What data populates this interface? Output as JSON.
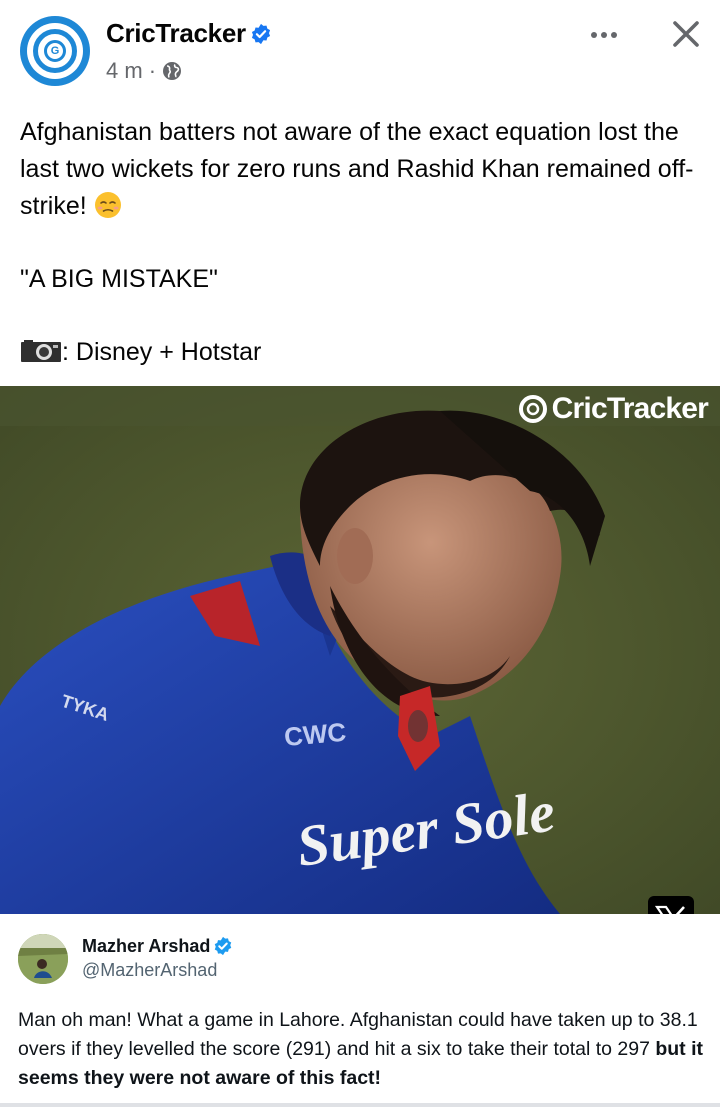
{
  "post": {
    "page_name": "CricTracker",
    "time": "4 m",
    "separator": "·",
    "text_line1": "Afghanistan batters not aware of the exact equation lost the last two wickets for zero runs and Rashid Khan remained off-strike!",
    "quote": "\"A BIG MISTAKE\"",
    "credit": ": Disney + Hotstar"
  },
  "media": {
    "watermark": "CricTracker",
    "jersey_text": "Super Sole"
  },
  "tweet": {
    "name": "Mazher Arshad",
    "handle": "@MazherArshad",
    "body_plain": "Man oh man! What a game in Lahore. Afghanistan could have taken up to 38.1 overs if they levelled the score (291) and hit a six to take their total to 297 ",
    "body_bold": "but it seems they were not aware of this fact!"
  },
  "colors": {
    "brand_blue": "#1e88d6",
    "verified_blue": "#1877f2",
    "meta_gray": "#65676b",
    "jersey_blue": "#1f3fa8",
    "field_green": "#4f5a2f"
  },
  "icons": [
    "page-logo",
    "verified-badge-icon",
    "globe-icon",
    "more-options-icon",
    "close-icon",
    "sad-face-emoji",
    "camera-icon",
    "x-logo-icon"
  ]
}
